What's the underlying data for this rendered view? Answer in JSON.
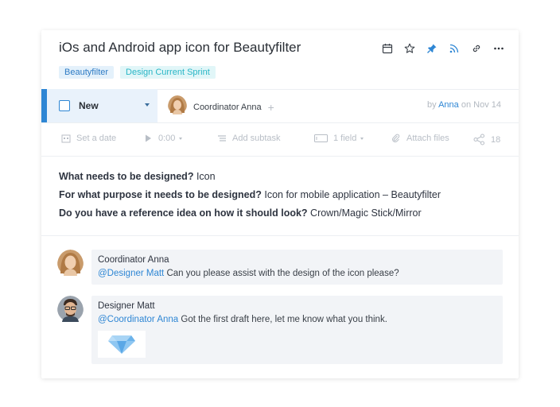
{
  "task": {
    "title": "iOs and Android app icon for Beautyfilter",
    "tags": [
      {
        "label": "Beautyfilter",
        "color": "#2e7bc4"
      },
      {
        "label": "Design Current Sprint",
        "color": "#29b6c6"
      }
    ],
    "header_icons": [
      "calendar-icon",
      "star-icon",
      "pin-icon",
      "rss-icon",
      "link-icon",
      "more-icon"
    ]
  },
  "status": {
    "label": "New",
    "accent": "#2e86d4",
    "assignee": "Coordinator Anna",
    "byline_prefix": "by",
    "byline_name": "Anna",
    "byline_suffix": "on Nov 14"
  },
  "toolbar": {
    "set_date": "Set a date",
    "timer": "0:00",
    "add_subtask": "Add subtask",
    "field": "1 field",
    "attach": "Attach files",
    "followers_count": "18"
  },
  "description": [
    {
      "q": "What needs to be designed?",
      "a": " Icon"
    },
    {
      "q": "For what purpose it needs to be designed?",
      "a": " Icon for mobile application – Beautyfilter"
    },
    {
      "q": "Do you have a reference idea on how it should look?",
      "a": " Crown/Magic Stick/Mirror"
    }
  ],
  "comments": [
    {
      "author": "Coordinator Anna",
      "mention": "@Designer Matt",
      "text": " Can you please assist with the design of the icon please?"
    },
    {
      "author": "Designer Matt",
      "mention": "@Coordinator Anna",
      "text": " Got the first draft here, let me know what you think."
    }
  ]
}
